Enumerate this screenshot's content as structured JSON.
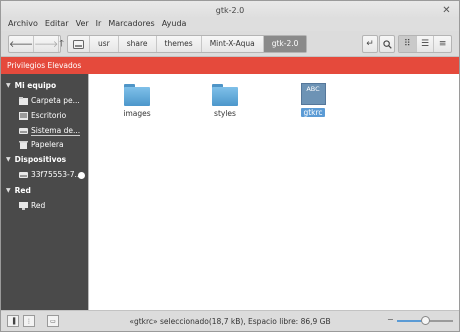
{
  "window": {
    "title": "gtk-2.0"
  },
  "menu": [
    "Archivo",
    "Editar",
    "Ver",
    "Ir",
    "Marcadores",
    "Ayuda"
  ],
  "breadcrumbs": [
    "usr",
    "share",
    "themes",
    "Mint-X-Aqua",
    "gtk-2.0"
  ],
  "banner": {
    "text": "Privilegios Elevados",
    "color": "#e54a3c"
  },
  "sidebar": {
    "sections": [
      {
        "title": "Mi equipo",
        "items": [
          "Carpeta pe...",
          "Escritorio",
          "Sistema de...",
          "Papelera"
        ]
      },
      {
        "title": "Dispositivos",
        "items": [
          "33f75553-7..."
        ]
      },
      {
        "title": "Red",
        "items": [
          "Red"
        ]
      }
    ]
  },
  "files": [
    {
      "name": "images",
      "type": "folder"
    },
    {
      "name": "styles",
      "type": "folder"
    },
    {
      "name": "gtkrc",
      "type": "text-document",
      "icon_label": "ABC",
      "selected": true
    }
  ],
  "status": {
    "text": "«gtkrc» seleccionado(18,7 kB), Espacio libre: 86,9 GB",
    "zoom": 0.5
  },
  "colors": {
    "accent": "#5b9bd5",
    "sidebar_bg": "#4a4a4a",
    "folder": "#5fa8d8"
  }
}
